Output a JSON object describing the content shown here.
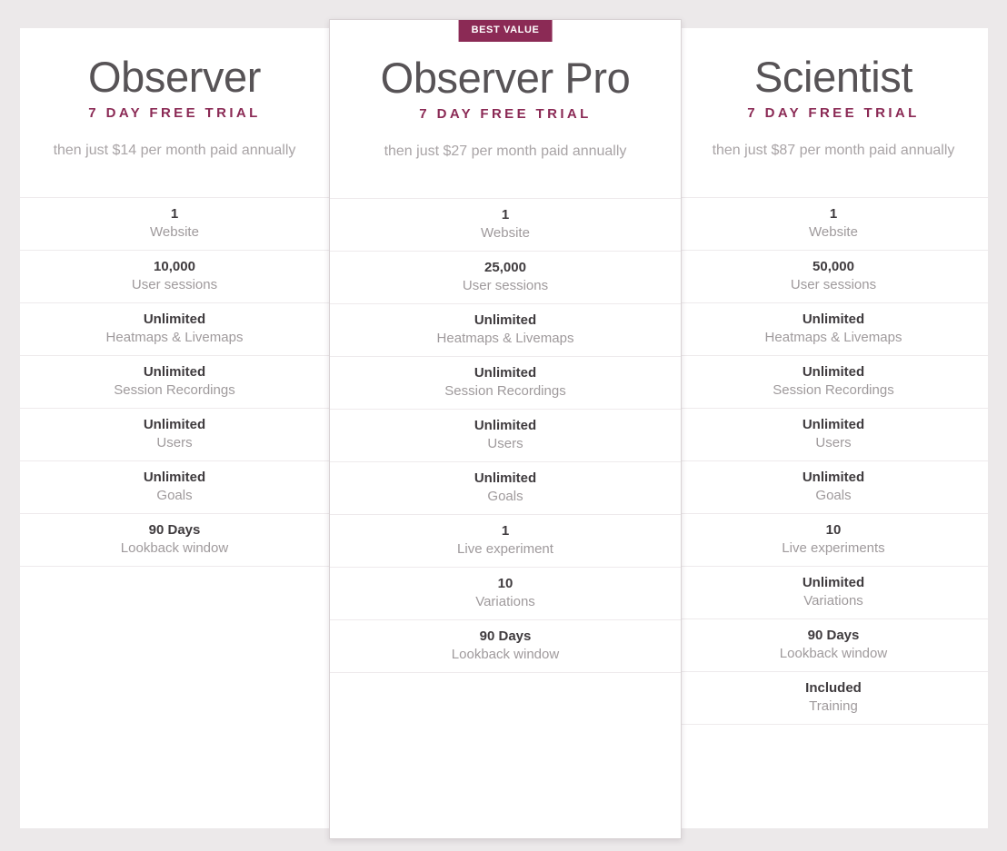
{
  "plans": [
    {
      "name": "Observer",
      "trial": "7 DAY FREE TRIAL",
      "price_note": "then just $14 per month paid annually",
      "badge": null,
      "featured": false,
      "features": [
        {
          "value": "1",
          "label": "Website"
        },
        {
          "value": "10,000",
          "label": "User sessions"
        },
        {
          "value": "Unlimited",
          "label": "Heatmaps & Livemaps"
        },
        {
          "value": "Unlimited",
          "label": "Session Recordings"
        },
        {
          "value": "Unlimited",
          "label": "Users"
        },
        {
          "value": "Unlimited",
          "label": "Goals"
        },
        {
          "value": "90 Days",
          "label": "Lookback window"
        }
      ]
    },
    {
      "name": "Observer Pro",
      "trial": "7 DAY FREE TRIAL",
      "price_note": "then just $27 per month paid annually",
      "badge": "BEST VALUE",
      "featured": true,
      "features": [
        {
          "value": "1",
          "label": "Website"
        },
        {
          "value": "25,000",
          "label": "User sessions"
        },
        {
          "value": "Unlimited",
          "label": "Heatmaps & Livemaps"
        },
        {
          "value": "Unlimited",
          "label": "Session Recordings"
        },
        {
          "value": "Unlimited",
          "label": "Users"
        },
        {
          "value": "Unlimited",
          "label": "Goals"
        },
        {
          "value": "1",
          "label": "Live experiment"
        },
        {
          "value": "10",
          "label": "Variations"
        },
        {
          "value": "90 Days",
          "label": "Lookback window"
        }
      ]
    },
    {
      "name": "Scientist",
      "trial": "7 DAY FREE TRIAL",
      "price_note": "then just $87 per month paid annually",
      "badge": null,
      "featured": false,
      "features": [
        {
          "value": "1",
          "label": "Website"
        },
        {
          "value": "50,000",
          "label": "User sessions"
        },
        {
          "value": "Unlimited",
          "label": "Heatmaps & Livemaps"
        },
        {
          "value": "Unlimited",
          "label": "Session Recordings"
        },
        {
          "value": "Unlimited",
          "label": "Users"
        },
        {
          "value": "Unlimited",
          "label": "Goals"
        },
        {
          "value": "10",
          "label": "Live experiments"
        },
        {
          "value": "Unlimited",
          "label": "Variations"
        },
        {
          "value": "90 Days",
          "label": "Lookback window"
        },
        {
          "value": "Included",
          "label": "Training"
        }
      ]
    }
  ],
  "colors": {
    "page_background": "#ece9ea",
    "card_background": "#ffffff",
    "accent": "#8b2a55",
    "plan_name": "#575356",
    "feature_value": "#3f3b3e",
    "feature_label": "#9f9a9c",
    "divider": "#eeeaec"
  }
}
